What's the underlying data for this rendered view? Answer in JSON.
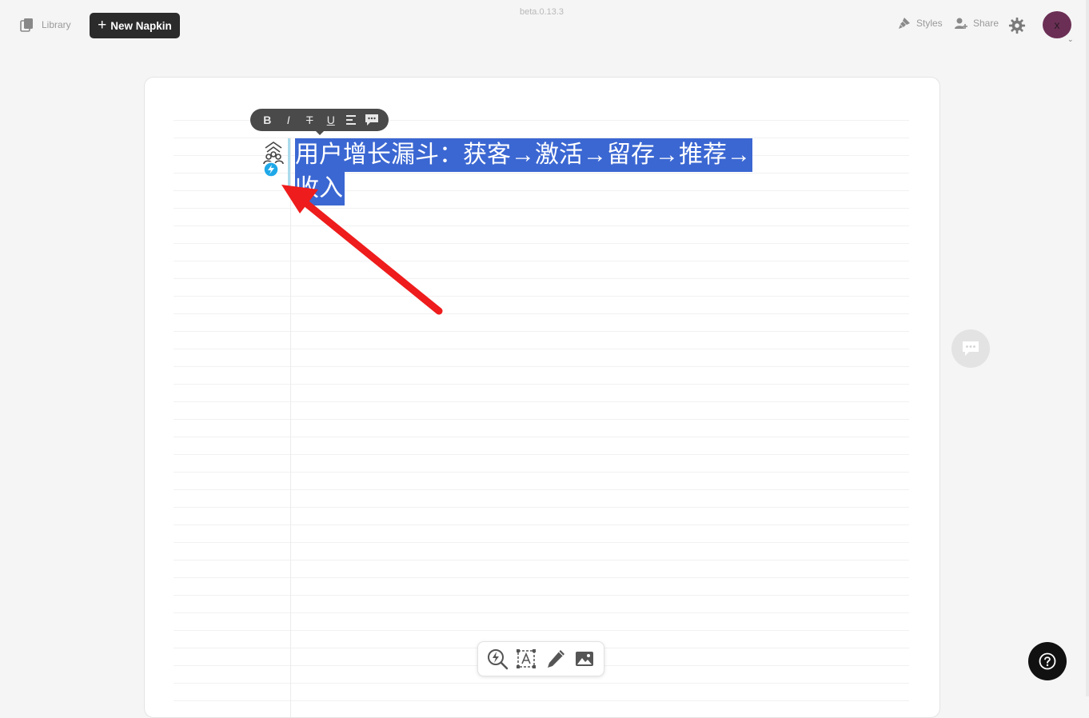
{
  "header": {
    "library_label": "Library",
    "new_napkin_label": "New Napkin",
    "version": "beta.0.13.3",
    "styles_label": "Styles",
    "share_label": "Share",
    "avatar_initial": "x"
  },
  "format_toolbar": {
    "bold": "B",
    "italic": "I",
    "strikethrough": "T",
    "underline": "U"
  },
  "editor": {
    "lines": [
      "用户增长漏斗：获客→激活→留存→推荐→",
      "收入"
    ]
  },
  "colors": {
    "selection": "#3b67d2",
    "avatar": "#6b2f55",
    "annotation_arrow": "#ee1c1c",
    "generate_badge": "#1fa8e8"
  },
  "icons": {
    "library": "library-icon",
    "styles": "brush-icon",
    "share": "add-user-icon",
    "settings": "gear-icon",
    "generate": "lightning-icon",
    "comment": "chat-icon",
    "insert_visual": "lightning-search-icon",
    "text_box": "text-box-icon",
    "draw": "pencil-icon",
    "image": "image-icon",
    "help": "question-icon"
  }
}
